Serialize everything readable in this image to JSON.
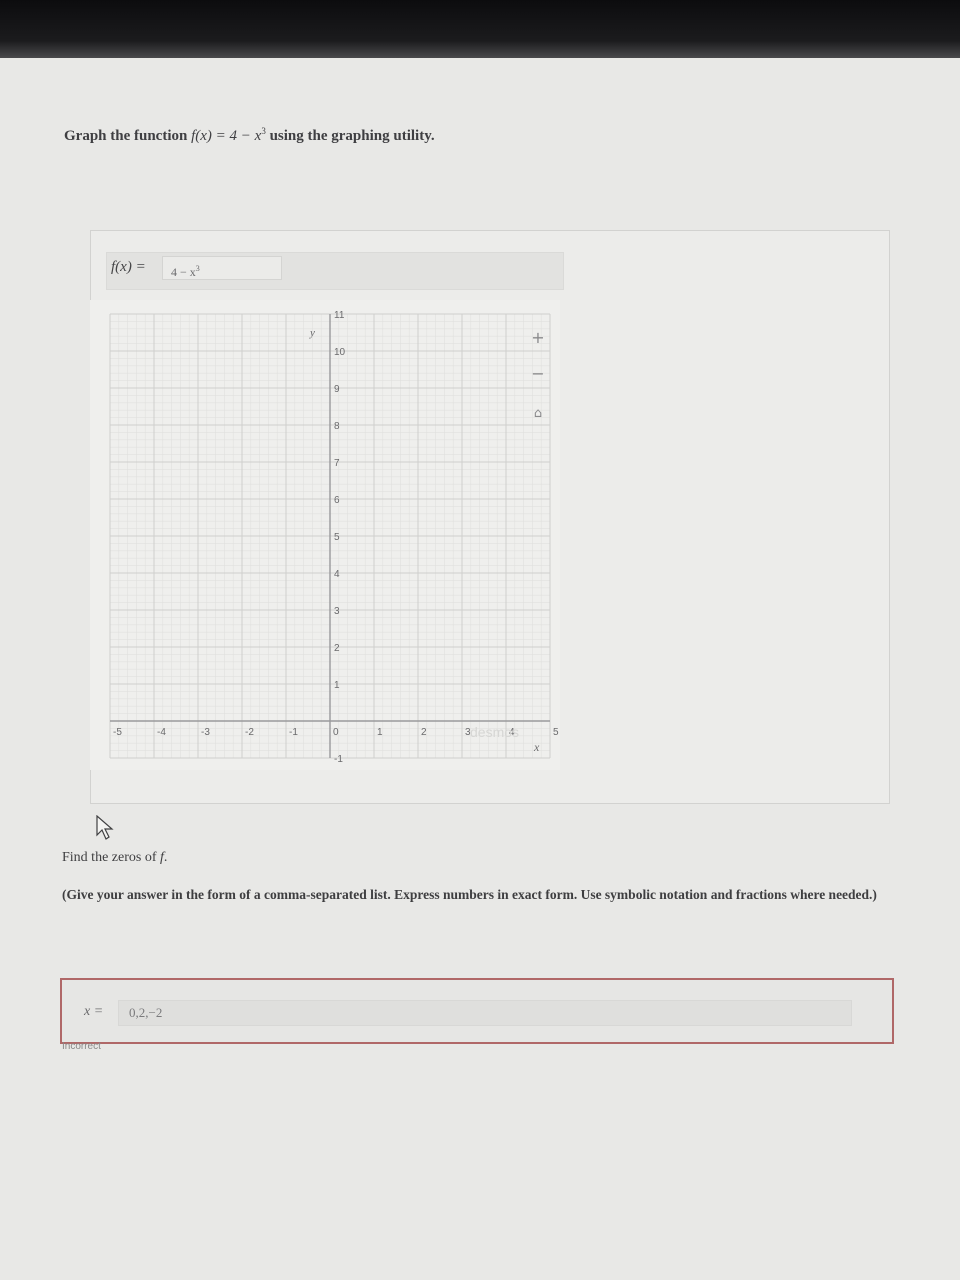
{
  "question": {
    "prefix": "Graph the function ",
    "function": "f(x) = 4 − x",
    "exponent": "3",
    "suffix": " using the graphing utility."
  },
  "graph": {
    "fx_label": "f(x) =",
    "fx_input_value": "4 − x",
    "fx_input_exponent": "3",
    "y_axis_label": "y",
    "x_axis_label": "x",
    "zoom_in_icon": "plus-icon",
    "zoom_out_icon": "minus-icon",
    "reset_icon": "home-icon",
    "watermark": "desmos"
  },
  "chart_data": {
    "type": "line",
    "xlim": [
      -5,
      5
    ],
    "ylim": [
      -1,
      11
    ],
    "x_ticks": [
      "-5",
      "-4",
      "-3",
      "-2",
      "-1",
      "0",
      "1",
      "2",
      "3",
      "4",
      "5"
    ],
    "y_ticks": [
      "-1",
      "1",
      "2",
      "3",
      "4",
      "5",
      "6",
      "7",
      "8",
      "9",
      "10",
      "11"
    ],
    "grid": true,
    "xlabel": "x",
    "ylabel": "y"
  },
  "prompt": {
    "find_text": "Find the zeros of ",
    "find_fn": "f",
    "instructions": "(Give your answer in the form of a comma-separated list. Express numbers in exact form. Use symbolic notation and fractions where needed.)"
  },
  "answer": {
    "label": "x =",
    "value": "0,2,−2",
    "status": "Incorrect",
    "status_color": "#b06868"
  }
}
